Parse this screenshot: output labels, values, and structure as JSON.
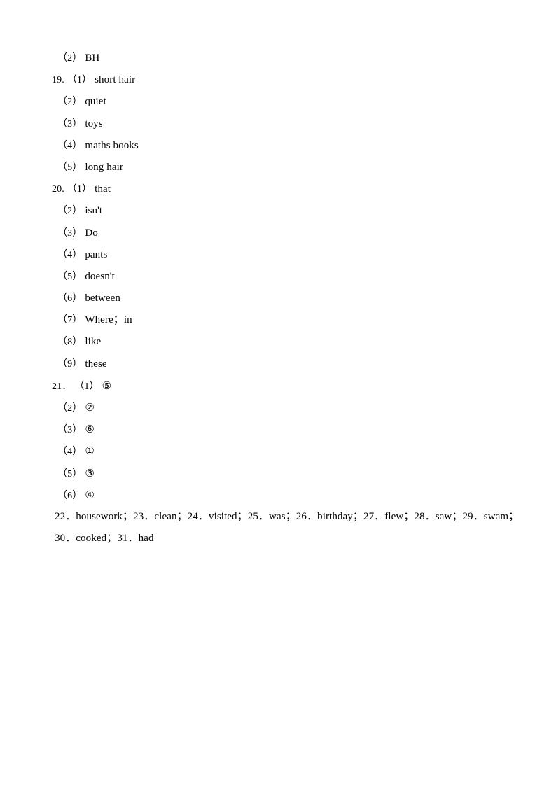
{
  "document": {
    "type": "answer-key",
    "page_background": "#ffffff",
    "text_color": "#000000"
  },
  "lines": [
    {
      "id": "q18-item2",
      "indent": "subitem",
      "number": "",
      "label": "（2）",
      "answer": "BH"
    },
    {
      "id": "q19-item1",
      "indent": "numbered",
      "number": "19.",
      "label": "（1）",
      "answer": "short hair"
    },
    {
      "id": "q19-item2",
      "indent": "subitem",
      "number": "",
      "label": "（2）",
      "answer": "quiet"
    },
    {
      "id": "q19-item3",
      "indent": "subitem",
      "number": "",
      "label": "（3）",
      "answer": "toys"
    },
    {
      "id": "q19-item4",
      "indent": "subitem",
      "number": "",
      "label": "（4）",
      "answer": "maths books"
    },
    {
      "id": "q19-item5",
      "indent": "subitem",
      "number": "",
      "label": "（5）",
      "answer": "long hair"
    },
    {
      "id": "q20-item1",
      "indent": "numbered",
      "number": "20.",
      "label": "（1）",
      "answer": "that"
    },
    {
      "id": "q20-item2",
      "indent": "subitem",
      "number": "",
      "label": "（2）",
      "answer": "isn't"
    },
    {
      "id": "q20-item3",
      "indent": "subitem",
      "number": "",
      "label": "（3）",
      "answer": "Do"
    },
    {
      "id": "q20-item4",
      "indent": "subitem",
      "number": "",
      "label": "（4）",
      "answer": "pants"
    },
    {
      "id": "q20-item5",
      "indent": "subitem",
      "number": "",
      "label": "（5）",
      "answer": "doesn't"
    },
    {
      "id": "q20-item6",
      "indent": "subitem",
      "number": "",
      "label": "（6）",
      "answer": "between"
    },
    {
      "id": "q20-item7",
      "indent": "subitem",
      "number": "",
      "label": "（7）",
      "answer": "Where；in"
    },
    {
      "id": "q20-item8",
      "indent": "subitem",
      "number": "",
      "label": "（8）",
      "answer": "like"
    },
    {
      "id": "q20-item9",
      "indent": "subitem",
      "number": "",
      "label": "（9）",
      "answer": "these"
    },
    {
      "id": "q21-item1",
      "indent": "numbered",
      "number": "21．",
      "label": "（1）",
      "answer": "⑤"
    },
    {
      "id": "q21-item2",
      "indent": "subitem",
      "number": "",
      "label": "（2）",
      "answer": "②"
    },
    {
      "id": "q21-item3",
      "indent": "subitem",
      "number": "",
      "label": "（3）",
      "answer": "⑥"
    },
    {
      "id": "q21-item4",
      "indent": "subitem",
      "number": "",
      "label": "（4）",
      "answer": "①"
    },
    {
      "id": "q21-item5",
      "indent": "subitem",
      "number": "",
      "label": "（5）",
      "answer": "③"
    },
    {
      "id": "q21-item6",
      "indent": "subitem",
      "number": "",
      "label": "（6）",
      "answer": "④"
    },
    {
      "id": "q22-to-29-run",
      "indent": "run",
      "number": "",
      "label": "",
      "answer": "22．housework；23．clean；24．visited；25．was；26．birthday；27．flew；28．saw；29．swam；"
    },
    {
      "id": "q30-to-31-run",
      "indent": "run",
      "number": "",
      "label": "",
      "answer": "30．cooked；31．had"
    }
  ]
}
